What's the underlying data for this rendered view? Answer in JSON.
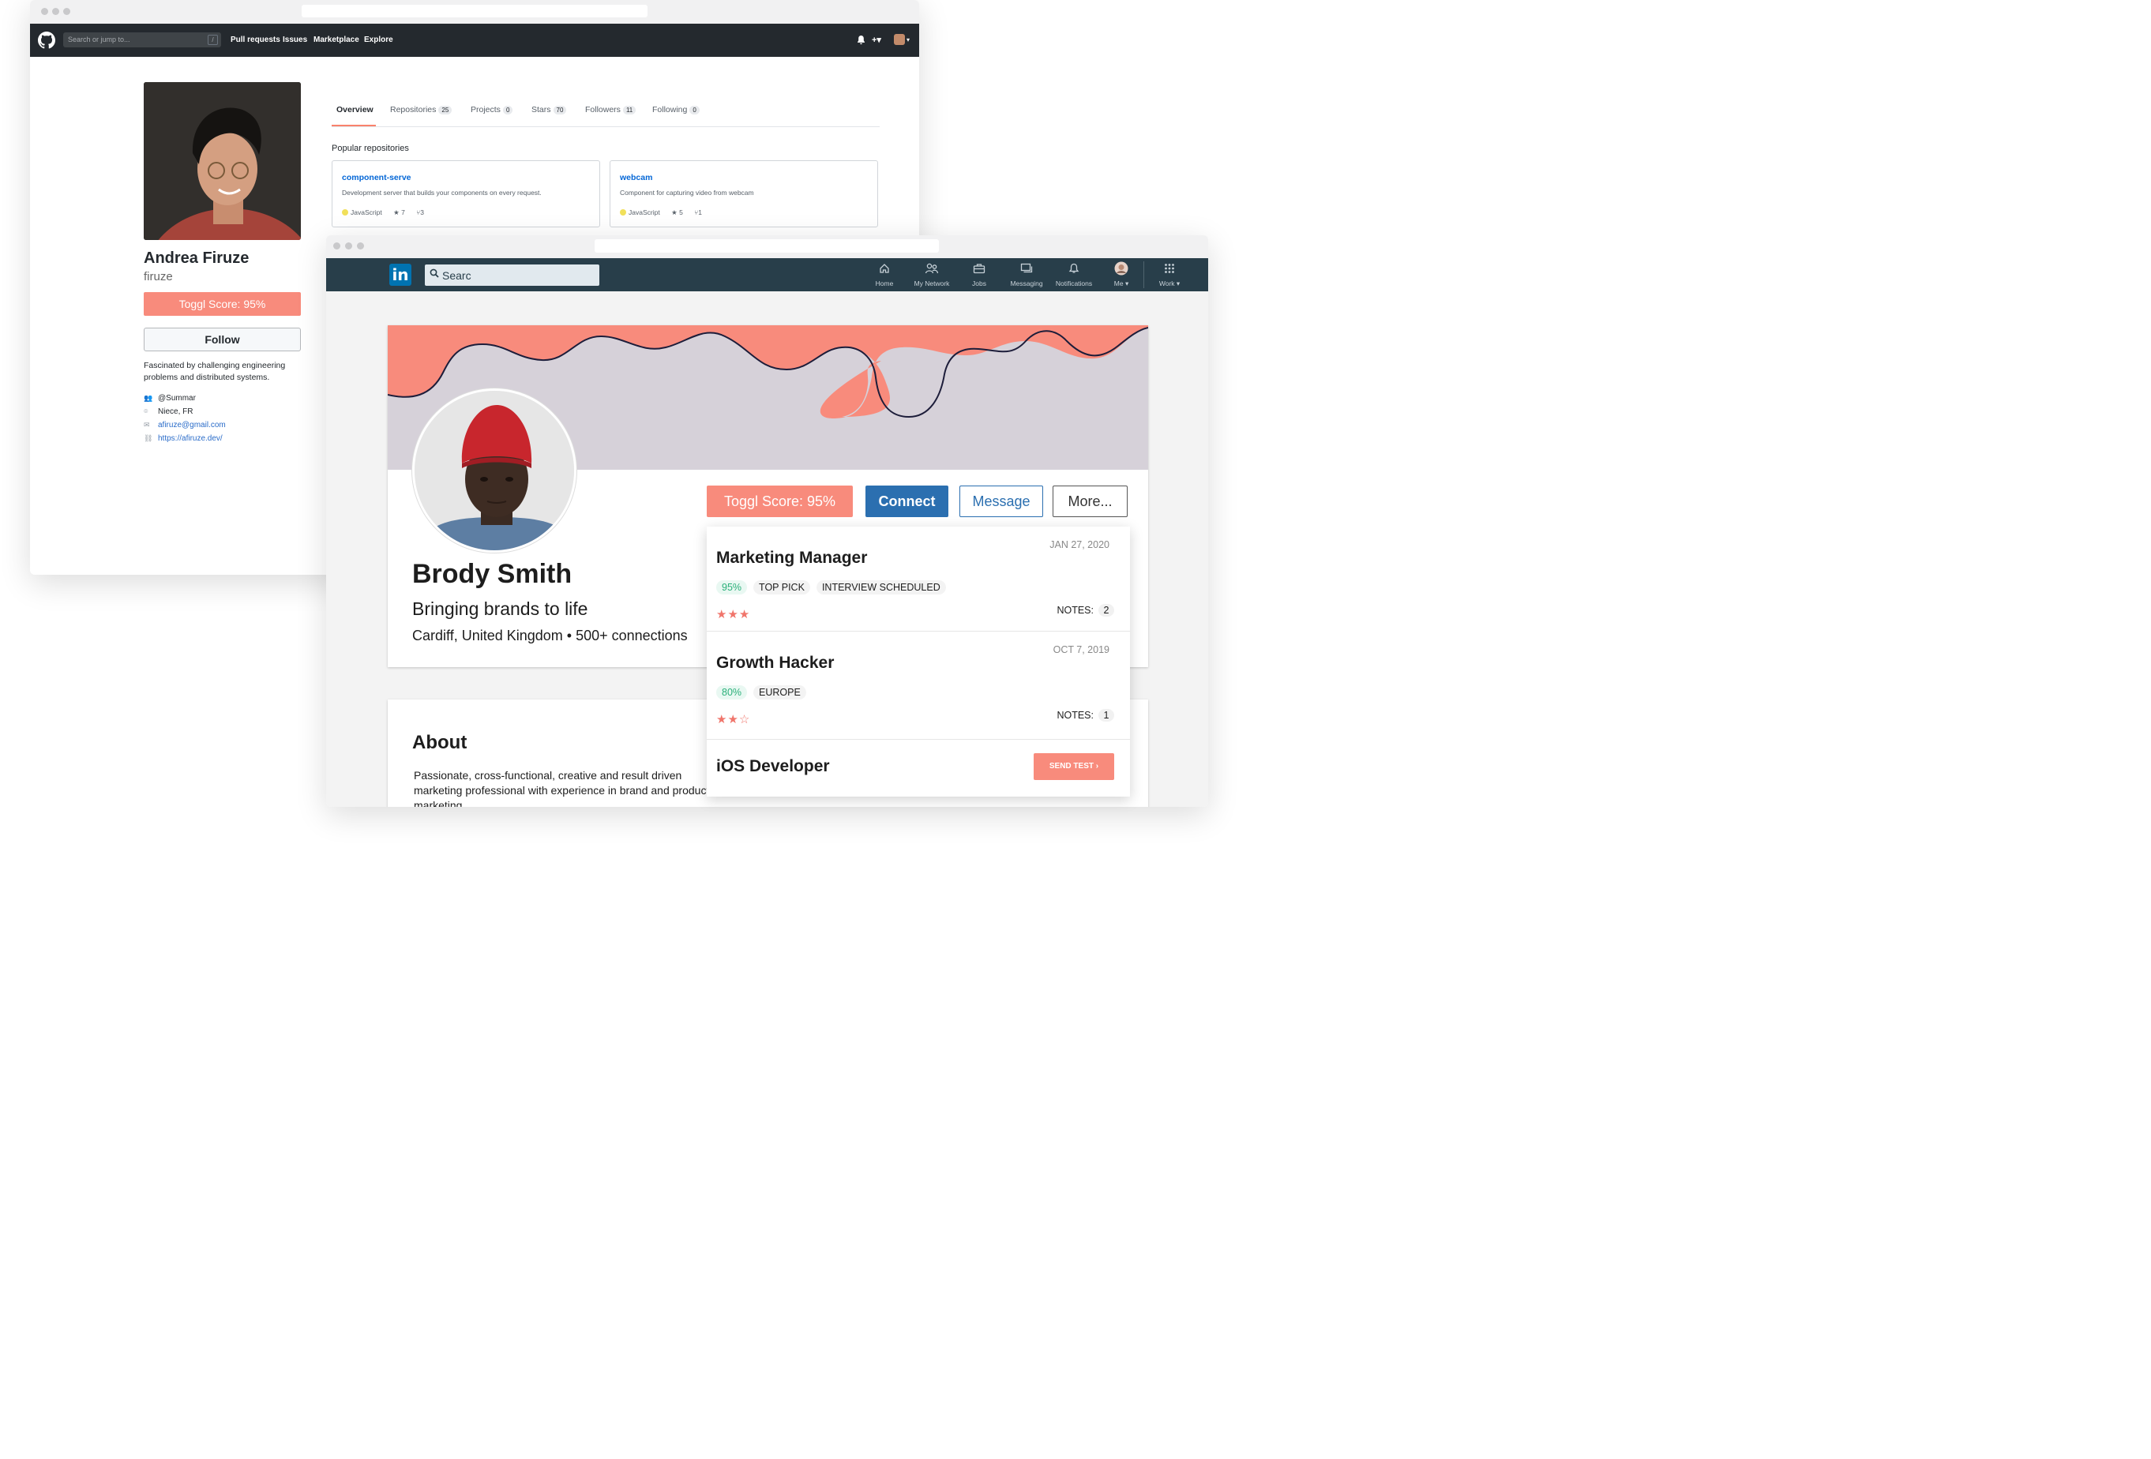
{
  "github": {
    "search_placeholder": "Search or jump to...",
    "search_shortcut": "/",
    "nav": [
      "Pull requests",
      "Issues",
      "Marketplace",
      "Explore"
    ],
    "plus_menu": "+▾",
    "profile": {
      "name": "Andrea Firuze",
      "username": "firuze",
      "toggl_score": "Toggl Score: 95%",
      "follow_label": "Follow",
      "bio": "Fascinated by challenging engineering problems and distributed systems.",
      "org": "@Summar",
      "location": "Niece, FR",
      "email": "afiruze@gmail.com",
      "website": "https://afiruze.dev/"
    },
    "tabs": [
      {
        "label": "Overview",
        "count": ""
      },
      {
        "label": "Repositories",
        "count": "25"
      },
      {
        "label": "Projects",
        "count": "0"
      },
      {
        "label": "Stars",
        "count": "70"
      },
      {
        "label": "Followers",
        "count": "11"
      },
      {
        "label": "Following",
        "count": "0"
      }
    ],
    "popular_title": "Popular repositories",
    "repos": [
      {
        "name": "component-serve",
        "description": "Development server that builds your components on every request.",
        "language": "JavaScript",
        "stars": "7",
        "forks": "3"
      },
      {
        "name": "webcam",
        "description": "Component for capturing video from webcam",
        "language": "JavaScript",
        "stars": "5",
        "forks": "1"
      }
    ]
  },
  "linkedin": {
    "logo": "in",
    "search_value": "Searc",
    "nav": [
      {
        "label": "Home",
        "icon": "home-icon"
      },
      {
        "label": "My Network",
        "icon": "network-icon"
      },
      {
        "label": "Jobs",
        "icon": "briefcase-icon"
      },
      {
        "label": "Messaging",
        "icon": "messaging-icon"
      },
      {
        "label": "Notifications",
        "icon": "bell-icon"
      },
      {
        "label": "Me ▾",
        "icon": "avatar"
      },
      {
        "label": "Work ▾",
        "icon": "grid-icon"
      }
    ],
    "profile": {
      "name": "Brody Smith",
      "headline": "Bringing brands to life",
      "location": "Cardiff, United Kingdom • 500+ connections"
    },
    "buttons": {
      "score": "Toggl Score:  95%",
      "connect": "Connect",
      "message": "Message",
      "more": "More..."
    },
    "about": {
      "title": "About",
      "text": "Passionate, cross-functional, creative and result driven marketing professional with experience in brand and product marketing."
    },
    "colors": {
      "banner_coral": "#f88b7c",
      "banner_grey": "#d6d1d9",
      "nav_bg": "#283e4a",
      "primary": "#2b6fb0"
    }
  },
  "toggl_panel": {
    "jobs": [
      {
        "title": "Marketing Manager",
        "date": "JAN 27, 2020",
        "score": "95%",
        "tags": [
          "TOP PICK",
          "INTERVIEW SCHEDULED"
        ],
        "rating": 3,
        "notes_label": "NOTES:",
        "notes": "2"
      },
      {
        "title": "Growth Hacker",
        "date": "OCT 7, 2019",
        "score": "80%",
        "tags": [
          "EUROPE"
        ],
        "rating": 2,
        "notes_label": "NOTES:",
        "notes": "1"
      },
      {
        "title": "iOS Developer",
        "action": "SEND TEST ›"
      }
    ]
  }
}
